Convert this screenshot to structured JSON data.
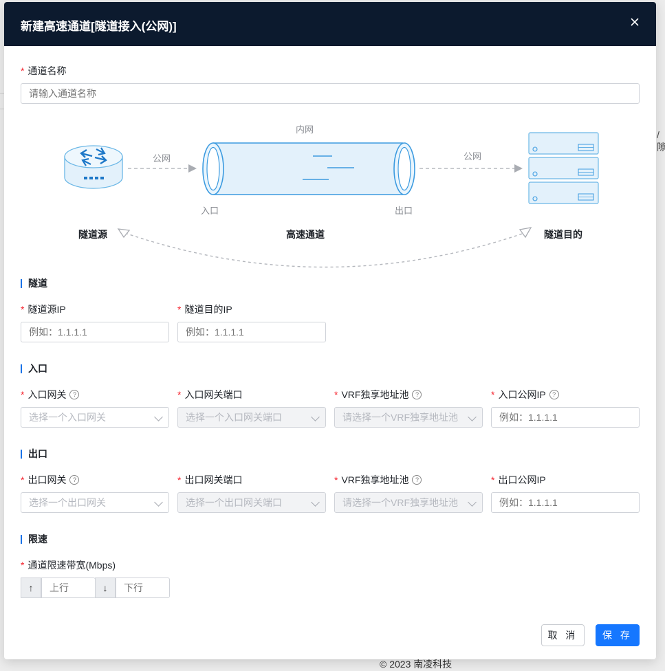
{
  "background": {
    "right_fragment": "/隙",
    "footer": "© 2023 南凌科技"
  },
  "modal": {
    "title": "新建高速通道[隧道接入(公网)]",
    "close": "X"
  },
  "channel_name": {
    "label": "通道名称",
    "placeholder": "请输入通道名称"
  },
  "diagram": {
    "inner_net": "内网",
    "public_net_left": "公网",
    "public_net_right": "公网",
    "entry": "入口",
    "exit": "出口",
    "tunnel_source": "隧道源",
    "high_speed_channel": "高速通道",
    "tunnel_destination": "隧道目的"
  },
  "tunnel_section": {
    "title": "隧道",
    "source_ip_label": "隧道源IP",
    "source_ip_placeholder": "例如：1.1.1.1",
    "dest_ip_label": "隧道目的IP",
    "dest_ip_placeholder": "例如：1.1.1.1"
  },
  "entry_section": {
    "title": "入口",
    "gateway_label": "入口网关",
    "gateway_placeholder": "选择一个入口网关",
    "port_label": "入口网关端口",
    "port_placeholder": "选择一个入口网关端口",
    "vrf_label": "VRF独享地址池",
    "vrf_placeholder": "请选择一个VRF独享地址池",
    "public_ip_label": "入口公网IP",
    "public_ip_placeholder": "例如：1.1.1.1"
  },
  "exit_section": {
    "title": "出口",
    "gateway_label": "出口网关",
    "gateway_placeholder": "选择一个出口网关",
    "port_label": "出口网关端口",
    "port_placeholder": "选择一个出口网关端口",
    "vrf_label": "VRF独享地址池",
    "vrf_placeholder": "请选择一个VRF独享地址池",
    "public_ip_label": "出口公网IP",
    "public_ip_placeholder": "例如：1.1.1.1"
  },
  "rate_section": {
    "title": "限速",
    "bandwidth_label": "通道限速带宽(Mbps)",
    "up_arrow": "↑",
    "up_placeholder": "上行",
    "down_arrow": "↓",
    "down_placeholder": "下行"
  },
  "footer_buttons": {
    "cancel": "取 消",
    "save": "保 存"
  },
  "colors": {
    "header_bg": "#0c1a2e",
    "primary": "#1677ff",
    "required": "#f5222d",
    "section_bar": "#1a73e8"
  }
}
